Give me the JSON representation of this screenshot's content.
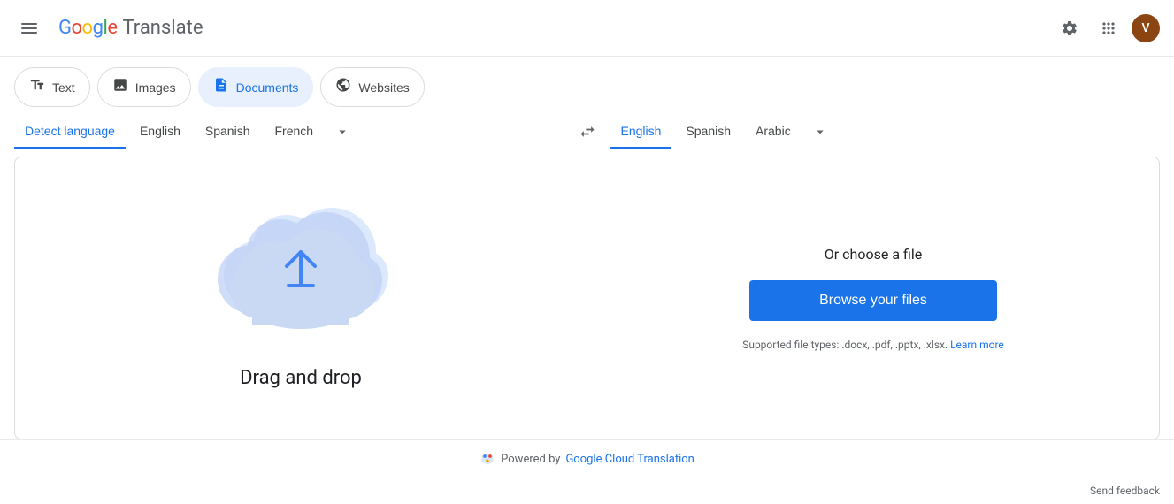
{
  "header": {
    "app_name": "Google Translate",
    "logo_letters": [
      "G",
      "o",
      "o",
      "g",
      "l",
      "e"
    ],
    "translate_label": "Translate",
    "avatar_initial": "V"
  },
  "mode_tabs": [
    {
      "id": "text",
      "label": "Text",
      "icon": "✎",
      "active": false
    },
    {
      "id": "images",
      "label": "Images",
      "icon": "🖼",
      "active": false
    },
    {
      "id": "documents",
      "label": "Documents",
      "icon": "📄",
      "active": true
    },
    {
      "id": "websites",
      "label": "Websites",
      "icon": "🌐",
      "active": false
    }
  ],
  "source_languages": [
    {
      "id": "detect",
      "label": "Detect language",
      "active": true
    },
    {
      "id": "english",
      "label": "English",
      "active": false
    },
    {
      "id": "spanish",
      "label": "Spanish",
      "active": false
    },
    {
      "id": "french",
      "label": "French",
      "active": false
    }
  ],
  "target_languages": [
    {
      "id": "english",
      "label": "English",
      "active": true
    },
    {
      "id": "spanish",
      "label": "Spanish",
      "active": false
    },
    {
      "id": "arabic",
      "label": "Arabic",
      "active": false
    }
  ],
  "main": {
    "drag_drop_text": "Drag and drop",
    "choose_title": "Or choose a file",
    "browse_button_label": "Browse your files",
    "supported_text": "Supported file types: .docx, .pdf, .pptx, .xlsx.",
    "learn_more_label": "Learn more"
  },
  "footer": {
    "powered_by_text": "Powered by",
    "powered_link_text": "Google Cloud Translation",
    "send_feedback_label": "Send feedback"
  },
  "icons": {
    "hamburger": "☰",
    "settings": "⚙",
    "apps": "⠿",
    "swap": "⇄",
    "chevron_down": "⌄"
  }
}
